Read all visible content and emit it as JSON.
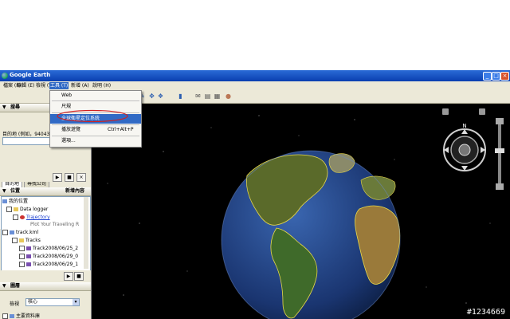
{
  "window": {
    "title": "Google Earth",
    "controls": [
      "_",
      "□",
      "×"
    ]
  },
  "menubar": {
    "items": [
      "檔案 (F)",
      "編輯 (E)",
      "檢視 (V)",
      "工具 (T)",
      "新增 (A)",
      "說明 (H)"
    ],
    "active_index": 3
  },
  "dropdown": {
    "items": [
      {
        "label": "Web",
        "shortcut": ""
      },
      {
        "label": "尺規",
        "shortcut": ""
      },
      {
        "label": "全球衛星定位系統",
        "shortcut": ""
      },
      {
        "label": "播放遊覽",
        "shortcut": "Ctrl+Alt+P"
      },
      {
        "label": "選項...",
        "shortcut": ""
      }
    ],
    "selected_index": 2
  },
  "search_panel": {
    "header": "搜尋",
    "tabs": [
      "目的地",
      "尋找公司"
    ],
    "label": "目的地 (例如，94043",
    "buttons": [
      "▶",
      "■",
      "×"
    ]
  },
  "places_panel": {
    "header": "位置",
    "add_content": "新增內容",
    "tree": [
      {
        "label": "我的位置",
        "indent": 0,
        "style": "normal"
      },
      {
        "label": "Data logger",
        "indent": 1,
        "style": "normal"
      },
      {
        "label": "Trajectory",
        "indent": 2,
        "style": "link"
      },
      {
        "label": "Plot Your Traveling R",
        "indent": 3,
        "style": "muted"
      },
      {
        "label": "track.kml",
        "indent": 0,
        "style": "normal"
      },
      {
        "label": "Tracks",
        "indent": 1,
        "style": "normal"
      },
      {
        "label": "Track2008/06/25_2",
        "indent": 2,
        "style": "normal"
      },
      {
        "label": "Track2008/06/29_0",
        "indent": 2,
        "style": "normal"
      },
      {
        "label": "Track2008/06/29_1",
        "indent": 2,
        "style": "normal"
      }
    ],
    "buttons": [
      "▶",
      "■",
      "×"
    ]
  },
  "layers_panel": {
    "header": "圖層",
    "view_label": "檢視",
    "view_value": "核心",
    "first_item": "主要資料庫"
  },
  "watermark": "#1234669",
  "colors": {
    "titlebar": "#0a3fb0",
    "selection": "#316ac5",
    "viewport": "#000000"
  }
}
